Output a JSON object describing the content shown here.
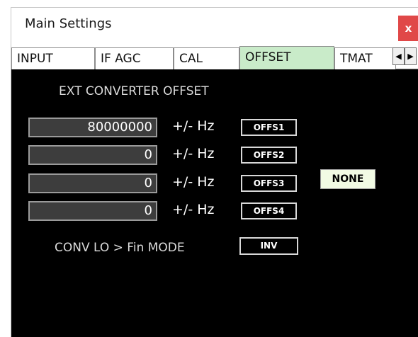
{
  "window": {
    "title": "Main Settings",
    "close_label": "x"
  },
  "tabs": [
    {
      "label": "INPUT",
      "active": false
    },
    {
      "label": "IF AGC",
      "active": false
    },
    {
      "label": "CAL",
      "active": false
    },
    {
      "label": "OFFSET",
      "active": true
    },
    {
      "label": "TMAT",
      "active": false
    }
  ],
  "tab_scroll": {
    "left_glyph": "◀",
    "right_glyph": "▶"
  },
  "panel": {
    "heading": "EXT CONVERTER OFFSET",
    "rows": [
      {
        "value": "80000000",
        "unit": "+/- Hz",
        "button": "OFFS1"
      },
      {
        "value": "0",
        "unit": "+/- Hz",
        "button": "OFFS2"
      },
      {
        "value": "0",
        "unit": "+/- Hz",
        "button": "OFFS3"
      },
      {
        "value": "0",
        "unit": "+/- Hz",
        "button": "OFFS4"
      }
    ],
    "none_button": "NONE",
    "mode_label": "CONV LO > Fin MODE",
    "mode_button": "INV"
  },
  "colors": {
    "active_tab": "#c9ebc9",
    "close_button": "#e04848",
    "panel_bg": "#000000",
    "none_button": "#f2fbe4"
  }
}
